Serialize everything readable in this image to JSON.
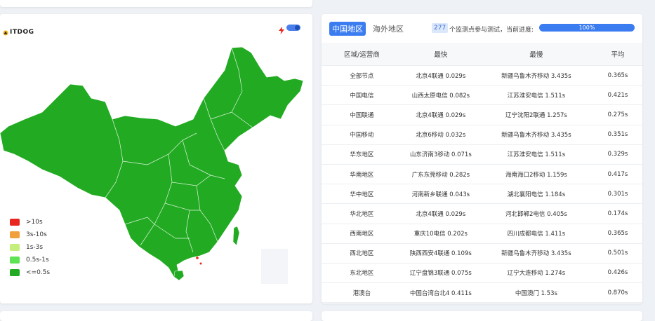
{
  "map_panel": {
    "logo_text": "ITDOG",
    "legend": [
      {
        "label": ">10s",
        "color": "#e8251e"
      },
      {
        "label": "3s-10s",
        "color": "#f0a03c"
      },
      {
        "label": "1s-3s",
        "color": "#c5ef7c"
      },
      {
        "label": "0.5s-1s",
        "color": "#5ee353"
      },
      {
        "label": "<=0.5s",
        "color": "#22ab22"
      }
    ],
    "map_fill": "#22ab22"
  },
  "table_panel": {
    "tabs": [
      {
        "label": "中国地区",
        "active": true
      },
      {
        "label": "海外地区",
        "active": false
      }
    ],
    "node_count": "277",
    "status_text": "个监测点参与测试，当前进度:",
    "progress_label": "100%",
    "progress": 1.0,
    "columns": [
      "区域/运营商",
      "最快",
      "最慢",
      "平均"
    ],
    "rows": [
      [
        "全部节点",
        "北京4联通 0.029s",
        "新疆乌鲁木齐移动 3.435s",
        "0.365s"
      ],
      [
        "中国电信",
        "山西太原电信 0.082s",
        "江苏淮安电信 1.511s",
        "0.421s"
      ],
      [
        "中国联通",
        "北京4联通 0.029s",
        "辽宁沈阳2联通 1.257s",
        "0.275s"
      ],
      [
        "中国移动",
        "北京6移动 0.032s",
        "新疆乌鲁木齐移动 3.435s",
        "0.351s"
      ],
      [
        "华东地区",
        "山东济南3移动 0.071s",
        "江苏淮安电信 1.511s",
        "0.329s"
      ],
      [
        "华南地区",
        "广东东莞移动 0.282s",
        "海南海口2移动 1.159s",
        "0.417s"
      ],
      [
        "华中地区",
        "河南新乡联通 0.043s",
        "湖北襄阳电信 1.184s",
        "0.301s"
      ],
      [
        "华北地区",
        "北京4联通 0.029s",
        "河北邯郸2电信 0.405s",
        "0.174s"
      ],
      [
        "西南地区",
        "重庆10电信 0.202s",
        "四川成都电信 1.411s",
        "0.365s"
      ],
      [
        "西北地区",
        "陕西西安4联通 0.109s",
        "新疆乌鲁木齐移动 3.435s",
        "0.501s"
      ],
      [
        "东北地区",
        "辽宁盘锦3联通 0.075s",
        "辽宁大连移动 1.274s",
        "0.426s"
      ],
      [
        "港澳台",
        "中国台湾台北4 0.411s",
        "中国澳门 1.53s",
        "0.870s"
      ]
    ]
  }
}
